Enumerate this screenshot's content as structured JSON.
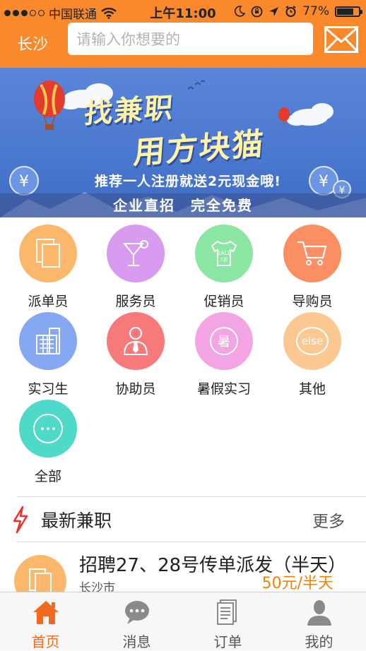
{
  "status_bar": {
    "carrier": "中国联通",
    "time": "上午11:00",
    "battery_percent": "77%",
    "battery_level": 0.77
  },
  "header": {
    "city": "长沙",
    "search_placeholder": "请输入你想要的",
    "mail_icon": "envelope-icon"
  },
  "banner": {
    "headline_1": "找兼职",
    "headline_2": "用方块猫",
    "promo": "推荐一人注册就送2元现金哦!",
    "slogan": "企业直招　完全免费"
  },
  "categories": [
    {
      "label": "派单员",
      "icon": "flyer-icon",
      "color": "#fbb86b"
    },
    {
      "label": "服务员",
      "icon": "cocktail-icon",
      "color": "#d99bf0"
    },
    {
      "label": "促销员",
      "icon": "sale-shirt-icon",
      "color": "#8be6a3"
    },
    {
      "label": "导购员",
      "icon": "shopping-cart-icon",
      "color": "#fb8e62"
    },
    {
      "label": "实习生",
      "icon": "building-icon",
      "color": "#86a8f2"
    },
    {
      "label": "协助员",
      "icon": "person-tie-icon",
      "color": "#f77a7a"
    },
    {
      "label": "暑假实习",
      "icon": "summer-icon",
      "color": "#f3a5e3",
      "icon_text": "暑"
    },
    {
      "label": "其他",
      "icon": "else-icon",
      "color": "#fcc892",
      "icon_text": "else"
    },
    {
      "label": "全部",
      "icon": "more-dots-icon",
      "color": "#4ed9c8"
    }
  ],
  "latest": {
    "title": "最新兼职",
    "more": "更多"
  },
  "job": {
    "title": "招聘27、28号传单派发（半天）",
    "city": "长沙市",
    "price": "50元/半天"
  },
  "tabs": [
    {
      "label": "首页",
      "icon": "home-icon",
      "active": true
    },
    {
      "label": "消息",
      "icon": "message-icon",
      "active": false
    },
    {
      "label": "订单",
      "icon": "order-icon",
      "active": false
    },
    {
      "label": "我的",
      "icon": "profile-icon",
      "active": false
    }
  ],
  "colors": {
    "brand_orange": "#f9892a",
    "active_tab": "#f06a20",
    "price": "#f08300"
  }
}
